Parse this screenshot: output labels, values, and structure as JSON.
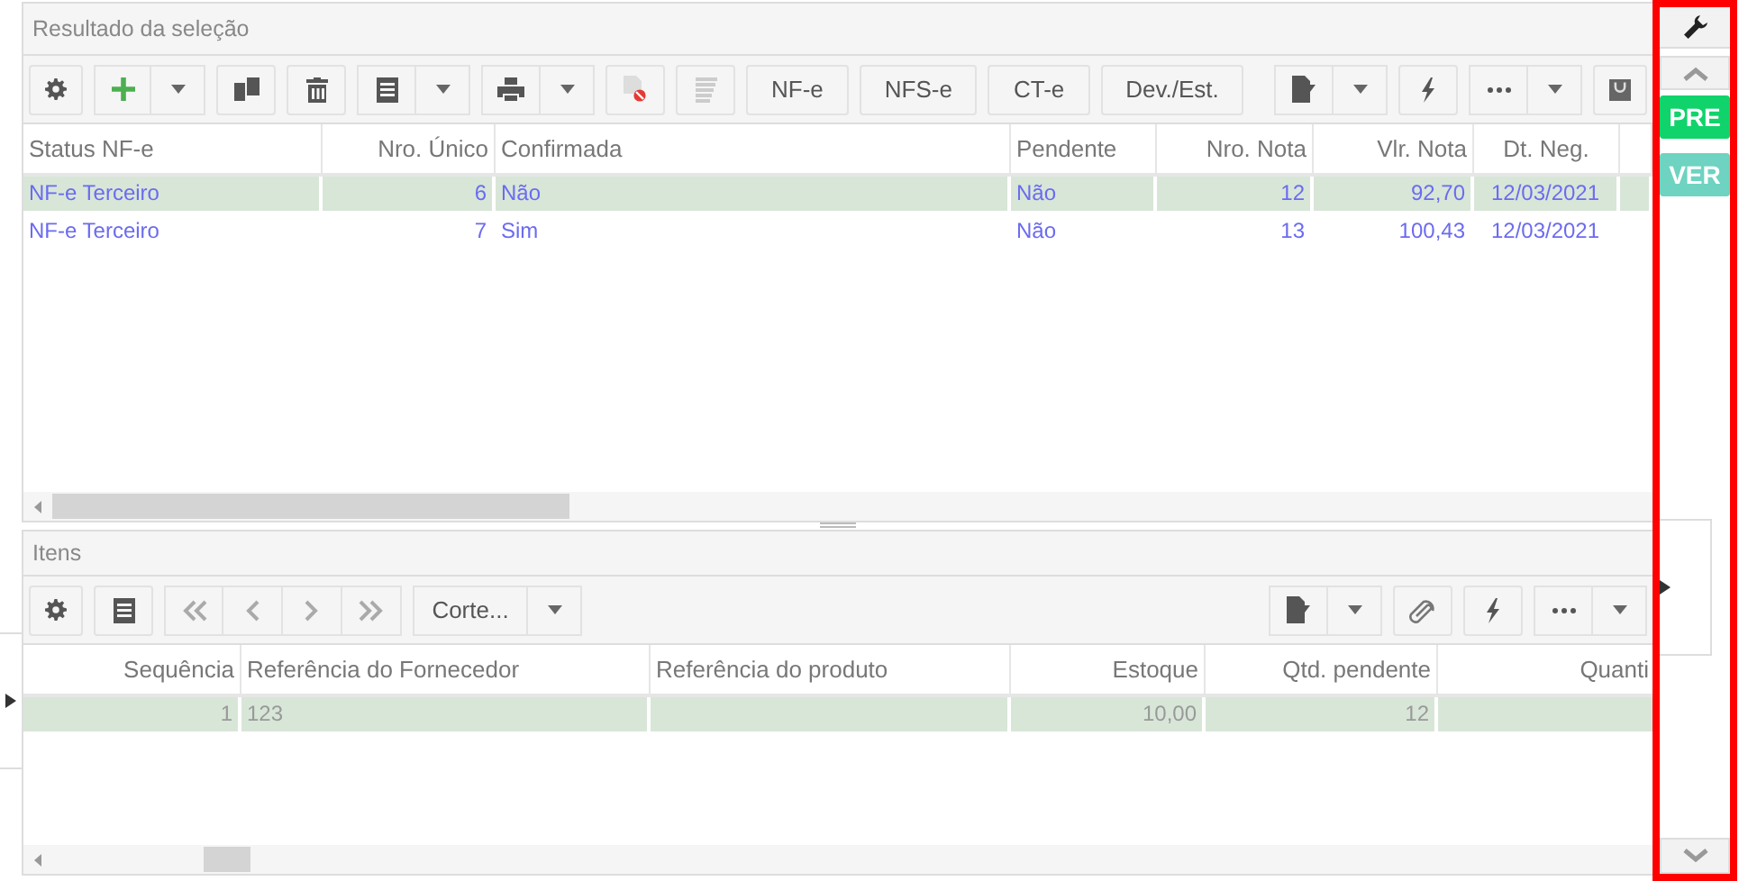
{
  "top_panel": {
    "title": "Resultado da seleção",
    "toolbar_buttons": [
      "NF-e",
      "NFS-e",
      "CT-e",
      "Dev./Est."
    ],
    "columns": [
      "Status NF-e",
      "Nro. Único",
      "Confirmada",
      "Pendente",
      "Nro. Nota",
      "Vlr. Nota",
      "Dt. Neg."
    ],
    "rows": [
      {
        "selected": true,
        "cells": [
          "NF-e Terceiro",
          "6",
          "Não",
          "Não",
          "12",
          "92,70",
          "12/03/2021"
        ]
      },
      {
        "selected": false,
        "cells": [
          "NF-e Terceiro",
          "7",
          "Sim",
          "Não",
          "13",
          "100,43",
          "12/03/2021"
        ]
      }
    ]
  },
  "bottom_panel": {
    "title": "Itens",
    "view_select": "Corte...",
    "columns": [
      "Sequência",
      "Referência do Fornecedor",
      "Referência do produto",
      "Estoque",
      "Qtd. pendente",
      "Quanti"
    ],
    "rows": [
      {
        "selected": true,
        "cells": [
          "1",
          "123",
          "",
          "10,00",
          "12",
          ""
        ]
      }
    ]
  },
  "side_bar": {
    "badges": [
      "PRE",
      "VER"
    ]
  }
}
